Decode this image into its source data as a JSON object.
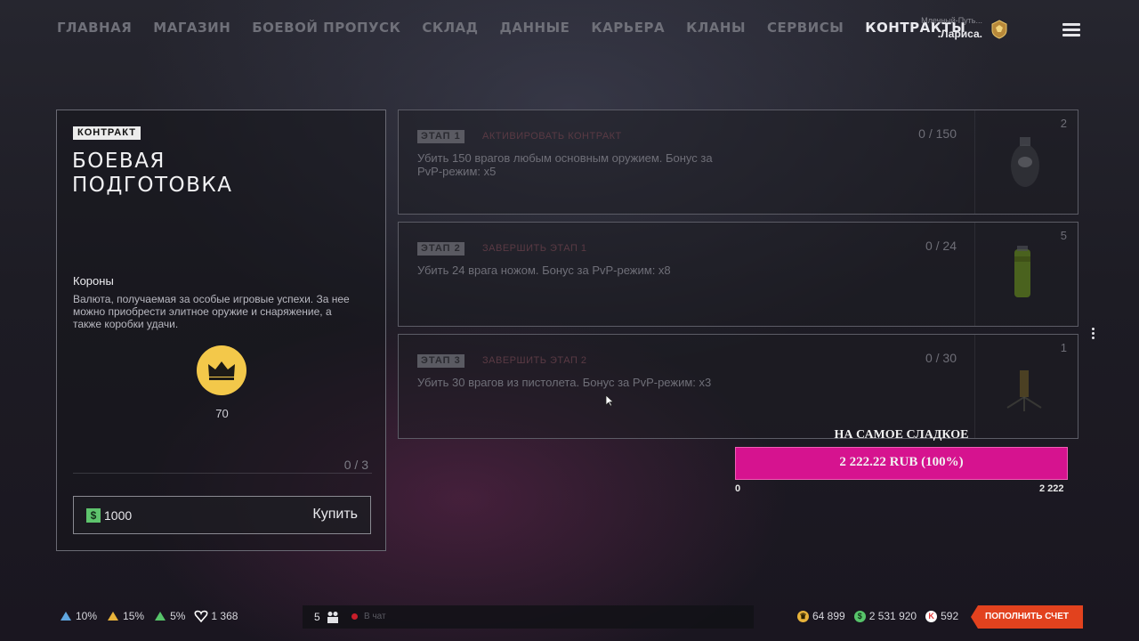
{
  "nav": {
    "items": [
      "ГЛАВНАЯ",
      "МАГАЗИН",
      "БОЕВОЙ ПРОПУСК",
      "СКЛАД",
      "ДАННЫЕ",
      "КАРЬЕРА",
      "КЛАНЫ",
      "СЕРВИСЫ",
      "КОНТРАКТЫ"
    ],
    "active": "КОНТРАКТЫ"
  },
  "profile": {
    "server": "Млечный-Путь...",
    "nickname": ".Лариса."
  },
  "contract": {
    "badge": "КОНТРАКТ",
    "title_line1": "БОЕВАЯ",
    "title_line2": "ПОДГОТОВКА",
    "reward_name": "Короны",
    "reward_description": "Валюта, получаемая за особые игровые успехи. За нее можно приобрести элитное оружие и снаряжение, а также коробки удачи.",
    "reward_quantity": "70",
    "progress": "0 / 3",
    "price": "1000",
    "buy_label": "Купить",
    "reward_icon": "crown-icon"
  },
  "stages": [
    {
      "tag": "ЭТАП 1",
      "status": "АКТИВИРОВАТЬ КОНТРАКТ",
      "description": "Убить 150 врагов любым основным оружием. Бонус за PvP-режим: x5",
      "progress": "0 / 150",
      "item_count": "2",
      "item_icon": "grenade-icon"
    },
    {
      "tag": "ЭТАП 2",
      "status": "ЗАВЕРШИТЬ ЭТАП 1",
      "description": "Убить 24 врага ножом. Бонус за PvP-режим: x8",
      "progress": "0 / 24",
      "item_count": "5",
      "item_icon": "smoke-canister-icon"
    },
    {
      "tag": "ЭТАП 3",
      "status": "ЗАВЕРШИТЬ ЭТАП 2",
      "description": "Убить 30 врагов из пистолета. Бонус за PvP-режим: x3",
      "progress": "0 / 30",
      "item_count": "1",
      "item_icon": "mine-icon"
    }
  ],
  "donation": {
    "title": "НА САМОЕ СЛАДКОЕ",
    "amount_text": "2 222.22 RUB (100%)",
    "fraction": 1.0,
    "min": "0",
    "max": "2 222",
    "color": "#d6138f"
  },
  "boosters": [
    {
      "icon": "experience-booster-icon",
      "value": "10%",
      "color": "#5fa6e0"
    },
    {
      "icon": "warbucks-booster-icon",
      "value": "15%",
      "color": "#e8b33a"
    },
    {
      "icon": "vip-booster-icon",
      "value": "5%",
      "color": "#57c46a"
    },
    {
      "icon": "heart-icon",
      "value": "1 368",
      "color": "#ffffff"
    }
  ],
  "chat": {
    "online_count": "5",
    "label": "В чат"
  },
  "currencies": [
    {
      "icon": "crown-icon",
      "value": "64 899",
      "color": "#e8b33a"
    },
    {
      "icon": "warbucks-icon",
      "value": "2 531 920",
      "color": "#57c46a"
    },
    {
      "icon": "kredits-icon",
      "value": "592",
      "color": "#e23a3a"
    }
  ],
  "topup_label": "ПОПОЛНИТЬ СЧЕТ"
}
